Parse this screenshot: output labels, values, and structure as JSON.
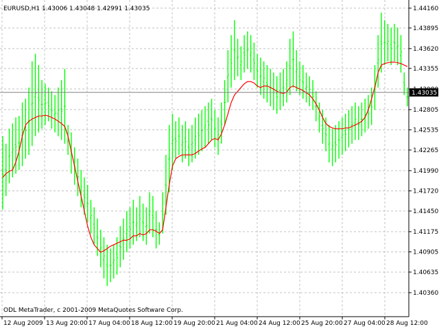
{
  "window": {
    "header": "EURUSD,H1  1.43006 1.43048 1.42991 1.43035",
    "footer": "ODL MetaTrader, c 2001-2009 MetaQuotes Software Corp.",
    "current_price_label": "1.43035"
  },
  "colors": {
    "background": "#ffffff",
    "bars": "#00ff00",
    "moving_average": "#ff0000",
    "grid": "#c0c0c0",
    "axis": "#000000",
    "price_marker_bg": "#000000",
    "price_marker_text": "#ffffff"
  },
  "chart_data": {
    "type": "line",
    "symbol": "EURUSD",
    "timeframe": "H1",
    "title": "EURUSD,H1  1.43006 1.43048 1.42991 1.43035",
    "grid": true,
    "price_scale_side": "right",
    "ylim": [
      1.4036,
      1.4415
    ],
    "y_ticks": [
      "1.44160",
      "1.43895",
      "1.43620",
      "1.43355",
      "1.43080",
      "1.42805",
      "1.42535",
      "1.42265",
      "1.41990",
      "1.41720",
      "1.41450",
      "1.41175",
      "1.40905",
      "1.40635",
      "1.40360"
    ],
    "x_ticks": [
      "12 Aug 2009",
      "13 Aug 20:00",
      "17 Aug 04:00",
      "18 Aug 12:00",
      "19 Aug 20:00",
      "21 Aug 04:00",
      "24 Aug 12:00",
      "25 Aug 20:00",
      "27 Aug 04:00",
      "28 Aug 12:00"
    ],
    "last_close": 1.43035,
    "bars": [
      [
        1.4147,
        1.4245
      ],
      [
        1.4165,
        1.4235
      ],
      [
        1.4182,
        1.4255
      ],
      [
        1.419,
        1.4262
      ],
      [
        1.4195,
        1.427
      ],
      [
        1.42,
        1.4272
      ],
      [
        1.4205,
        1.429
      ],
      [
        1.4215,
        1.4295
      ],
      [
        1.422,
        1.431
      ],
      [
        1.4232,
        1.4345
      ],
      [
        1.4245,
        1.4355
      ],
      [
        1.425,
        1.434
      ],
      [
        1.4255,
        1.432
      ],
      [
        1.426,
        1.4315
      ],
      [
        1.4265,
        1.431
      ],
      [
        1.4255,
        1.4305
      ],
      [
        1.425,
        1.43
      ],
      [
        1.4245,
        1.431
      ],
      [
        1.424,
        1.432
      ],
      [
        1.4235,
        1.4335
      ],
      [
        1.422,
        1.426
      ],
      [
        1.4195,
        1.425
      ],
      [
        1.418,
        1.423
      ],
      [
        1.4165,
        1.4215
      ],
      [
        1.415,
        1.42
      ],
      [
        1.414,
        1.419
      ],
      [
        1.413,
        1.418
      ],
      [
        1.4115,
        1.416
      ],
      [
        1.41,
        1.415
      ],
      [
        1.4085,
        1.4135
      ],
      [
        1.407,
        1.412
      ],
      [
        1.4055,
        1.411
      ],
      [
        1.4045,
        1.41
      ],
      [
        1.405,
        1.4095
      ],
      [
        1.4055,
        1.41
      ],
      [
        1.406,
        1.411
      ],
      [
        1.407,
        1.4125
      ],
      [
        1.408,
        1.4135
      ],
      [
        1.409,
        1.4145
      ],
      [
        1.4095,
        1.415
      ],
      [
        1.41,
        1.416
      ],
      [
        1.4105,
        1.415
      ],
      [
        1.411,
        1.4165
      ],
      [
        1.4105,
        1.4155
      ],
      [
        1.41,
        1.415
      ],
      [
        1.4115,
        1.417
      ],
      [
        1.411,
        1.4165
      ],
      [
        1.4095,
        1.4145
      ],
      [
        1.41,
        1.413
      ],
      [
        1.4115,
        1.417
      ],
      [
        1.414,
        1.422
      ],
      [
        1.417,
        1.426
      ],
      [
        1.42,
        1.4275
      ],
      [
        1.4215,
        1.4265
      ],
      [
        1.422,
        1.427
      ],
      [
        1.421,
        1.426
      ],
      [
        1.4215,
        1.4265
      ],
      [
        1.4205,
        1.4255
      ],
      [
        1.421,
        1.426
      ],
      [
        1.4215,
        1.427
      ],
      [
        1.422,
        1.4275
      ],
      [
        1.4225,
        1.428
      ],
      [
        1.423,
        1.4285
      ],
      [
        1.4235,
        1.429
      ],
      [
        1.424,
        1.4295
      ],
      [
        1.423,
        1.428
      ],
      [
        1.422,
        1.427
      ],
      [
        1.4235,
        1.429
      ],
      [
        1.426,
        1.432
      ],
      [
        1.429,
        1.436
      ],
      [
        1.431,
        1.438
      ],
      [
        1.432,
        1.44
      ],
      [
        1.4325,
        1.4375
      ],
      [
        1.432,
        1.4365
      ],
      [
        1.433,
        1.438
      ],
      [
        1.4335,
        1.4385
      ],
      [
        1.433,
        1.438
      ],
      [
        1.432,
        1.437
      ],
      [
        1.431,
        1.4355
      ],
      [
        1.43,
        1.435
      ],
      [
        1.4295,
        1.4345
      ],
      [
        1.429,
        1.434
      ],
      [
        1.4285,
        1.4335
      ],
      [
        1.428,
        1.433
      ],
      [
        1.4275,
        1.4325
      ],
      [
        1.428,
        1.433
      ],
      [
        1.4285,
        1.4335
      ],
      [
        1.429,
        1.4345
      ],
      [
        1.43,
        1.4375
      ],
      [
        1.431,
        1.4385
      ],
      [
        1.4305,
        1.436
      ],
      [
        1.43,
        1.4345
      ],
      [
        1.4295,
        1.434
      ],
      [
        1.429,
        1.433
      ],
      [
        1.4285,
        1.4325
      ],
      [
        1.428,
        1.432
      ],
      [
        1.4265,
        1.4305
      ],
      [
        1.425,
        1.429
      ],
      [
        1.4235,
        1.428
      ],
      [
        1.4225,
        1.427
      ],
      [
        1.421,
        1.426
      ],
      [
        1.4205,
        1.4255
      ],
      [
        1.421,
        1.426
      ],
      [
        1.4215,
        1.4265
      ],
      [
        1.422,
        1.427
      ],
      [
        1.4225,
        1.4275
      ],
      [
        1.423,
        1.428
      ],
      [
        1.4235,
        1.4285
      ],
      [
        1.424,
        1.429
      ],
      [
        1.424,
        1.4285
      ],
      [
        1.4245,
        1.429
      ],
      [
        1.425,
        1.4295
      ],
      [
        1.4255,
        1.43
      ],
      [
        1.426,
        1.431
      ],
      [
        1.428,
        1.434
      ],
      [
        1.431,
        1.438
      ],
      [
        1.433,
        1.441
      ],
      [
        1.434,
        1.44
      ],
      [
        1.4345,
        1.4395
      ],
      [
        1.434,
        1.439
      ],
      [
        1.4345,
        1.4395
      ],
      [
        1.434,
        1.439
      ],
      [
        1.433,
        1.438
      ],
      [
        1.43,
        1.433
      ],
      [
        1.4285,
        1.431
      ]
    ],
    "moving_average": [
      1.419,
      1.4195,
      1.4198,
      1.42,
      1.421,
      1.4225,
      1.4245,
      1.426,
      1.4265,
      1.4268,
      1.427,
      1.4272,
      1.4272,
      1.4273,
      1.4272,
      1.427,
      1.4268,
      1.4265,
      1.4262,
      1.4258,
      1.4245,
      1.4225,
      1.4205,
      1.4185,
      1.4165,
      1.4145,
      1.4125,
      1.411,
      1.41,
      1.4095,
      1.409,
      1.4092,
      1.4095,
      1.4098,
      1.41,
      1.4102,
      1.4104,
      1.4106,
      1.4106,
      1.4108,
      1.4112,
      1.4112,
      1.4115,
      1.4113,
      1.4115,
      1.412,
      1.412,
      1.4118,
      1.4115,
      1.412,
      1.415,
      1.418,
      1.4205,
      1.4215,
      1.4218,
      1.422,
      1.422,
      1.422,
      1.422,
      1.4222,
      1.4225,
      1.4228,
      1.423,
      1.4235,
      1.424,
      1.4242,
      1.424,
      1.4248,
      1.426,
      1.4275,
      1.429,
      1.43,
      1.4305,
      1.431,
      1.4315,
      1.4318,
      1.4318,
      1.4316,
      1.4312,
      1.431,
      1.4312,
      1.4312,
      1.431,
      1.4308,
      1.4305,
      1.4303,
      1.4302,
      1.4304,
      1.431,
      1.4312,
      1.431,
      1.4308,
      1.4306,
      1.4303,
      1.43,
      1.4295,
      1.4288,
      1.428,
      1.427,
      1.4262,
      1.4258,
      1.4256,
      1.4255,
      1.4255,
      1.4255,
      1.4256,
      1.4256,
      1.4258,
      1.426,
      1.4262,
      1.4265,
      1.427,
      1.428,
      1.4295,
      1.431,
      1.433,
      1.434,
      1.4342,
      1.4343,
      1.4344,
      1.4344,
      1.4343,
      1.4342,
      1.434,
      1.4338
    ]
  }
}
